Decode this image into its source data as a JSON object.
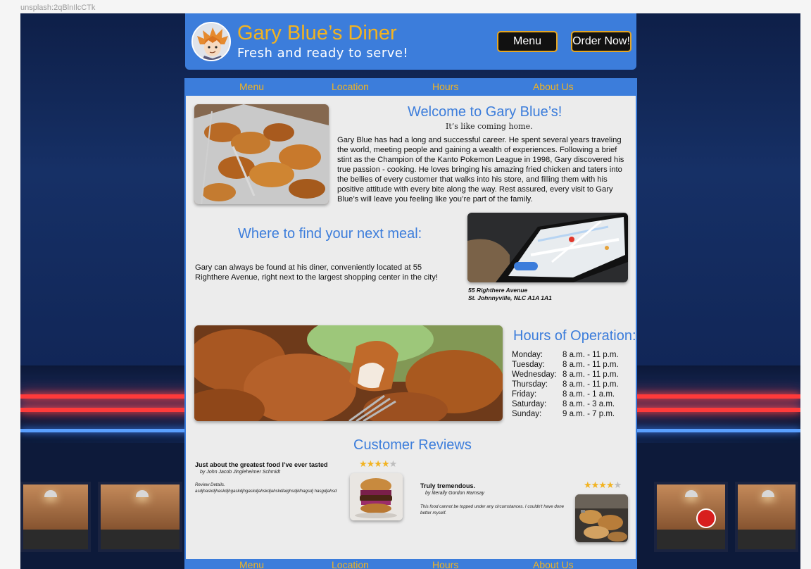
{
  "frame_label": "unsplash:2qBlnIlcCTk",
  "header": {
    "title": "Gary Blue’s Diner",
    "tagline": "Fresh and ready to serve!",
    "menu_button": "Menu",
    "order_button": "Order Now!"
  },
  "nav": {
    "items": [
      "Menu",
      "Location",
      "Hours",
      "About Us"
    ]
  },
  "welcome": {
    "heading": "Welcome to Gary Blue’s!",
    "subheading": "It’s like coming home.",
    "body": "Gary Blue has had a long and successful career. He spent several years traveling the world, meeting people and gaining a wealth of experiences. Following a brief stint as the Champion of the Kanto Pokemon League in 1998, Gary discovered his true passion - cooking. He loves bringing his amazing fried chicken and taters into the bellies of every customer that walks into his store, and filling them with his positive attitude with every bite along the way. Rest assured, every visit to Gary Blue’s will leave you feeling like you’re part of the family."
  },
  "location": {
    "heading": "Where to find your next meal:",
    "body": "Gary can always be found at his diner, conveniently located at 55 Righthere Avenue, right next to the largest shopping center in the city!",
    "address_line1": "55 Righthere Avenue",
    "address_line2": "St. Johnnyville, NLC A1A 1A1"
  },
  "hours": {
    "heading": "Hours of Operation:",
    "rows": [
      {
        "day": "Monday:",
        "time": "8 a.m. - 11 p.m."
      },
      {
        "day": "Tuesday:",
        "time": "8 a.m. - 11 p.m."
      },
      {
        "day": "Wednesday:",
        "time": "8 a.m. - 11 p.m."
      },
      {
        "day": "Thursday:",
        "time": "8 a.m. - 11 p.m."
      },
      {
        "day": "Friday:",
        "time": "8 a.m. - 1 a.m."
      },
      {
        "day": "Saturday:",
        "time": "8 a.m. - 3 a.m."
      },
      {
        "day": "Sunday:",
        "time": "9 a.m. - 7 p.m."
      }
    ]
  },
  "reviews": {
    "heading": "Customer Reviews",
    "items": [
      {
        "title": "Just about the greatest food I’ve ever tasted",
        "author": "by John Jacob Jingleheimer Schmidt",
        "body": "Review Details. asdjhaskdjhaskdjhgaskdjhgaskdjahskdjahskdlaighsdjklhagsdj hasgdjahsd",
        "rating": 4,
        "max": 5
      },
      {
        "title": "Truly tremendous.",
        "author": "by literally Gordon Ramsay",
        "body": "This food cannot be topped under any circumstances. I couldn't have done better myself.",
        "rating": 4,
        "max": 5
      }
    ]
  },
  "colors": {
    "brand_blue": "#3c7ddb",
    "brand_gold": "#f2b321",
    "panel_bg": "#ececec"
  }
}
